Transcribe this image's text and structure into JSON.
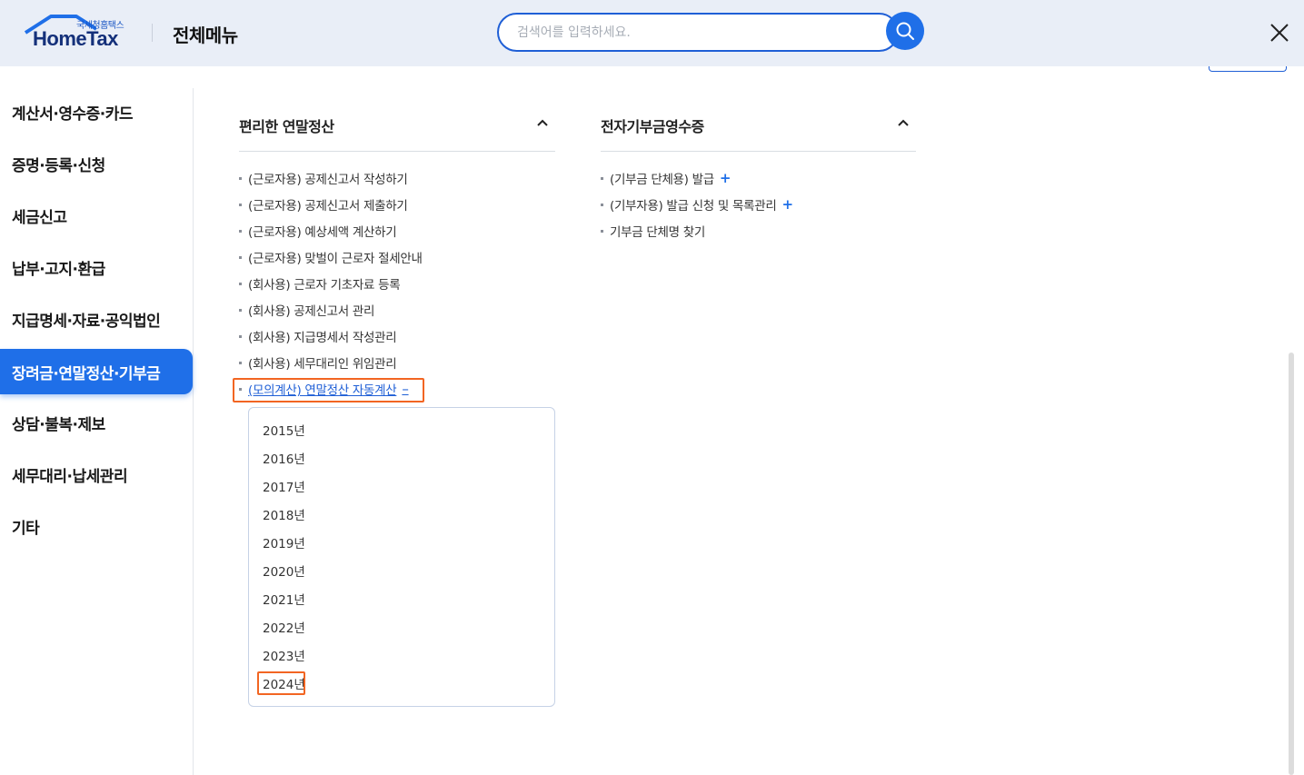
{
  "header": {
    "logo_sub": "국세청홈택스",
    "logo_brand": "HomeTax",
    "title": "전체메뉴",
    "search_placeholder": "검색어를 입력하세요."
  },
  "sidebar": {
    "items": [
      {
        "label": "계산서·영수증·카드",
        "active": false
      },
      {
        "label": "증명·등록·신청",
        "active": false
      },
      {
        "label": "세금신고",
        "active": false
      },
      {
        "label": "납부·고지·환급",
        "active": false
      },
      {
        "label": "지급명세·자료·공익법인",
        "active": false
      },
      {
        "label": "장려금·연말정산·기부금",
        "active": true
      },
      {
        "label": "상담·불복·제보",
        "active": false
      },
      {
        "label": "세무대리·납세관리",
        "active": false
      },
      {
        "label": "기타",
        "active": false
      }
    ]
  },
  "sections": {
    "left": {
      "title": "편리한 연말정산",
      "items": [
        "(근로자용) 공제신고서 작성하기",
        "(근로자용) 공제신고서 제출하기",
        "(근로자용) 예상세액 계산하기",
        "(근로자용) 맞벌이 근로자 절세안내",
        "(회사용) 근로자 기초자료 등록",
        "(회사용) 공제신고서 관리",
        "(회사용) 지급명세서 작성관리",
        "(회사용) 세무대리인 위임관리"
      ],
      "expanded_item": "(모의계산) 연말정산 자동계산",
      "expanded_toggle": "–",
      "years": [
        "2015년",
        "2016년",
        "2017년",
        "2018년",
        "2019년",
        "2020년",
        "2021년",
        "2022년",
        "2023년",
        "2024년"
      ]
    },
    "right": {
      "title": "전자기부금영수증",
      "items": [
        {
          "label": "(기부금 단체용) 발급",
          "toggle": "+"
        },
        {
          "label": "(기부자용) 발급 신청 및 목록관리",
          "toggle": "+"
        },
        {
          "label": "기부금 단체명 찾기",
          "toggle": ""
        }
      ]
    }
  },
  "colors": {
    "accent": "#1f6fe8",
    "highlight": "#f26522",
    "header_bg": "#e9eef7"
  }
}
